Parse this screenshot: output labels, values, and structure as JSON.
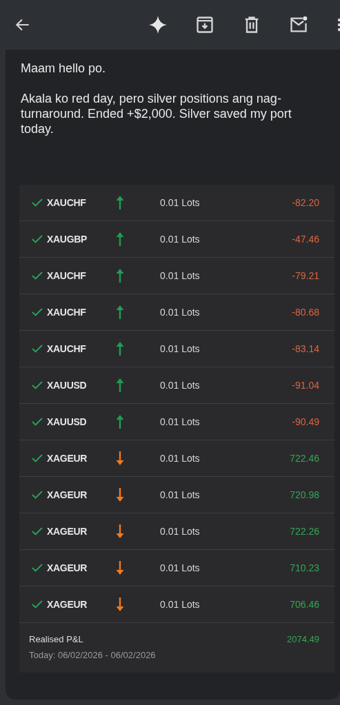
{
  "message": {
    "greeting": "Maam hello po.",
    "body": "Akala ko red day, pero silver positions ang nag-turnaround. Ended +$2,000. Silver saved my port today."
  },
  "trades": [
    {
      "symbol": "XAUCHF",
      "kind": "up",
      "lots": "0.01 Lots",
      "pnl": "-82.20",
      "profit": false
    },
    {
      "symbol": "XAUGBP",
      "kind": "up",
      "lots": "0.01 Lots",
      "pnl": "-47.46",
      "profit": false
    },
    {
      "symbol": "XAUCHF",
      "kind": "up",
      "lots": "0.01 Lots",
      "pnl": "-79.21",
      "profit": false
    },
    {
      "symbol": "XAUCHF",
      "kind": "up",
      "lots": "0.01 Lots",
      "pnl": "-80.68",
      "profit": false
    },
    {
      "symbol": "XAUCHF",
      "kind": "up",
      "lots": "0.01 Lots",
      "pnl": "-83.14",
      "profit": false
    },
    {
      "symbol": "XAUUSD",
      "kind": "up",
      "lots": "0.01 Lots",
      "pnl": "-91.04",
      "profit": false
    },
    {
      "symbol": "XAUUSD",
      "kind": "up",
      "lots": "0.01 Lots",
      "pnl": "-90.49",
      "profit": false
    },
    {
      "symbol": "XAGEUR",
      "kind": "down",
      "lots": "0.01 Lots",
      "pnl": "722.46",
      "profit": true
    },
    {
      "symbol": "XAGEUR",
      "kind": "down",
      "lots": "0.01 Lots",
      "pnl": "720.98",
      "profit": true
    },
    {
      "symbol": "XAGEUR",
      "kind": "down",
      "lots": "0.01 Lots",
      "pnl": "722.26",
      "profit": true
    },
    {
      "symbol": "XAGEUR",
      "kind": "down",
      "lots": "0.01 Lots",
      "pnl": "710.23",
      "profit": true
    },
    {
      "symbol": "XAGEUR",
      "kind": "down",
      "lots": "0.01 Lots",
      "pnl": "706.46",
      "profit": true
    }
  ],
  "summary": {
    "label": "Realised P&L",
    "value": "2074.49",
    "profit": true,
    "period": "Today: 06/02/2026 - 06/02/2026"
  }
}
